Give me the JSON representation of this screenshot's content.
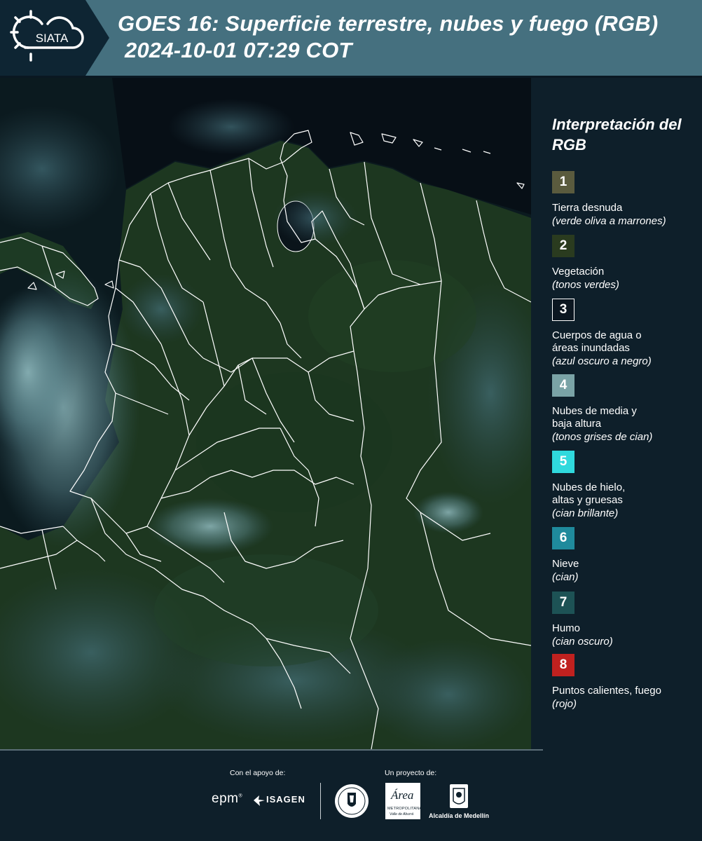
{
  "header": {
    "title_line1": "GOES 16: Superficie terrestre, nubes y fuego (RGB)",
    "title_line2": "2024-10-01 07:29 COT",
    "logo_text": "SIATA",
    "logo_icon": "sun-cloud-icon"
  },
  "map": {
    "description_icon": "satellite-map-image",
    "colors": {
      "land": "#1e3a22",
      "ocean": "#071018",
      "cloud": "#6e9aa0",
      "borders": "#ffffff"
    }
  },
  "legend": {
    "title": "Interpretación del RGB",
    "items": [
      {
        "number": "1",
        "label": "Tierra desnuda",
        "desc": "(verde oliva a marrones)",
        "color": "#5a5b3e",
        "outline": false
      },
      {
        "number": "2",
        "label": "Vegetación",
        "desc": "(tonos verdes)",
        "color": "#2a3b1f",
        "outline": false
      },
      {
        "number": "3",
        "label": "Cuerpos de agua o áreas inundadas",
        "desc": "(azul oscuro a negro)",
        "color": "#0b1620",
        "outline": true
      },
      {
        "number": "4",
        "label": "Nubes de media y baja altura",
        "desc": "(tonos grises de cian)",
        "color": "#7aa3a6",
        "outline": false
      },
      {
        "number": "5",
        "label": "Nubes de hielo, altas y gruesas",
        "desc": "(cian brillante)",
        "color": "#2fd9dd",
        "outline": false
      },
      {
        "number": "6",
        "label": "Nieve",
        "desc": "(cian)",
        "color": "#1f8a9c",
        "outline": false
      },
      {
        "number": "7",
        "label": "Humo",
        "desc": "(cian oscuro)",
        "color": "#1d5255",
        "outline": false
      },
      {
        "number": "8",
        "label": "Puntos calientes, fuego",
        "desc": "(rojo)",
        "color": "#c0211f",
        "outline": false
      }
    ]
  },
  "footer": {
    "support_caption": "Con el apoyo de:",
    "project_caption": "Un proyecto de:",
    "sponsors": {
      "epm": "epm",
      "isagen": "ISAGEN",
      "area_metropolitana": "Área",
      "area_sub": "METROPOLITANA",
      "area_sub2": "Valle de Aburrá",
      "alcaldia": "Alcaldía de Medellín"
    }
  }
}
